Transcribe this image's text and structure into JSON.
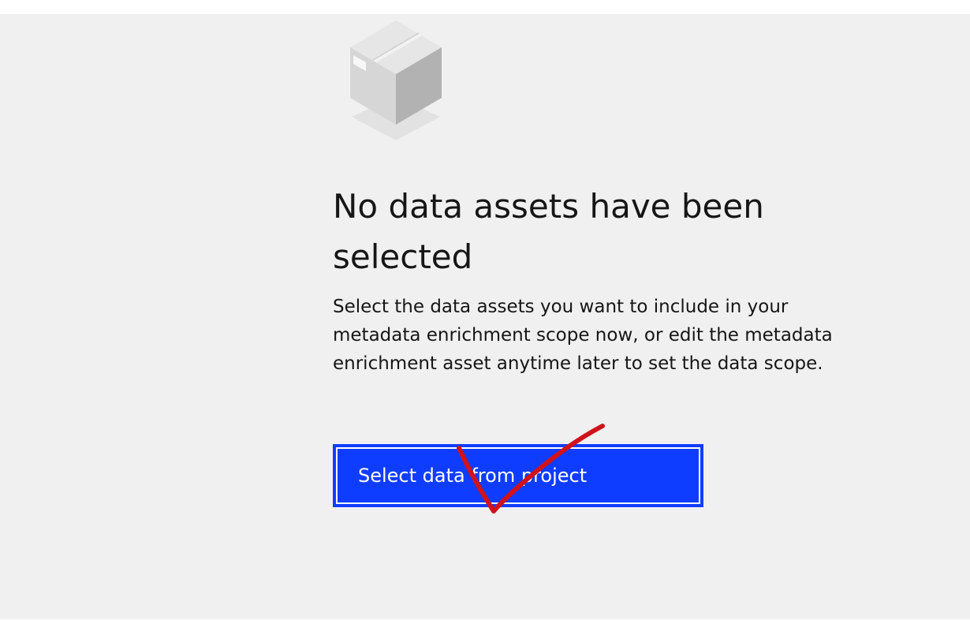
{
  "empty_state": {
    "illustration_icon": "package-box-icon",
    "title": "No data assets have been selected",
    "description": "Select the data assets you want to include in your metadata enrichment scope now, or edit the metadata enrichment asset anytime later to set the data scope.",
    "primary_action_label": "Select data from project"
  },
  "colors": {
    "panel_background": "#f0f0f0",
    "primary_button": "#0f3dff",
    "text": "#161616",
    "annotation_mark": "#d0121b"
  },
  "annotation": {
    "icon": "red-checkmark-icon"
  }
}
